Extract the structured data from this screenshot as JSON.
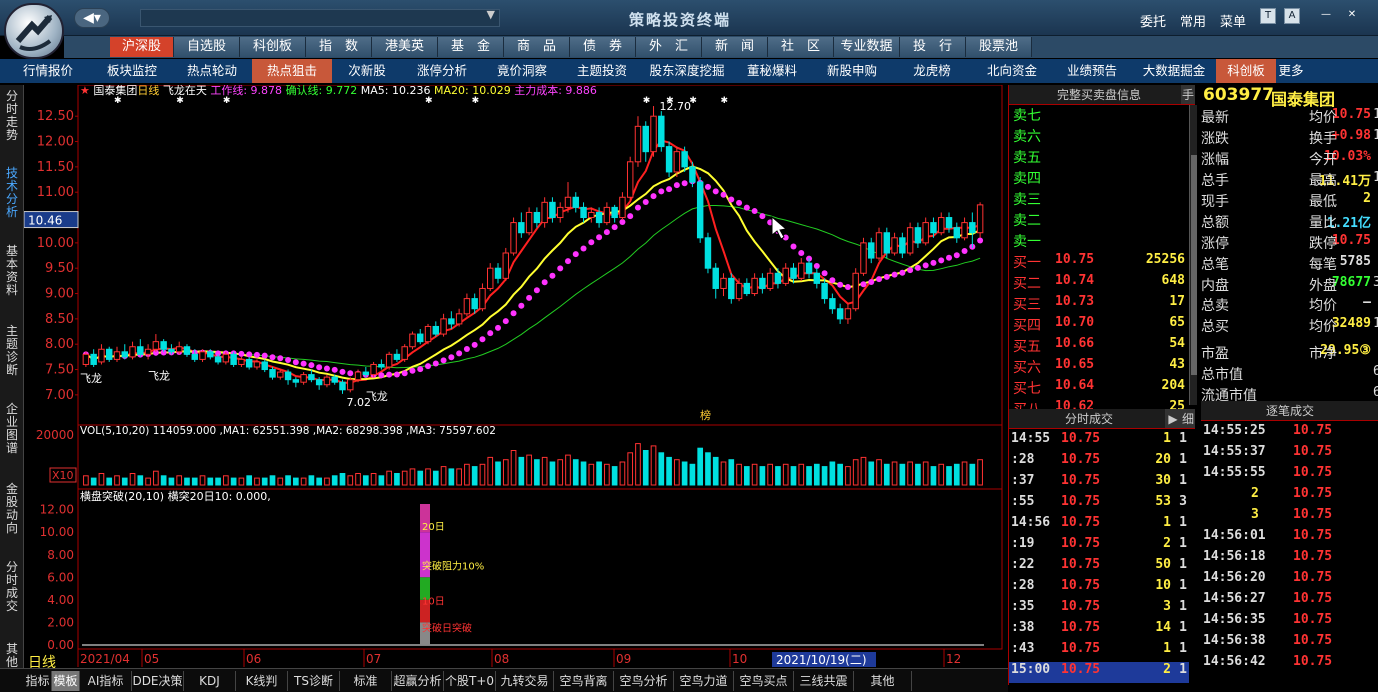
{
  "app": {
    "title": "策略投资终端",
    "links": [
      "委托",
      "常用",
      "菜单"
    ]
  },
  "menu": {
    "items": [
      "沪深股",
      "自选股",
      "科创板",
      "指　数",
      "港美英",
      "基　金",
      "商　品",
      "债　券",
      "外　汇",
      "新　闻",
      "社　区",
      "专业数据",
      "投　行",
      "股票池"
    ],
    "active": 0
  },
  "submenu": {
    "items": [
      "行情报价",
      "板块监控",
      "热点轮动",
      "热点狙击",
      "次新股",
      "涨停分析",
      "竟价洞察",
      "主题投资",
      "股东深度挖掘",
      "董秘爆料",
      "新股申购",
      "龙虎榜",
      "北向资金",
      "业绩预告",
      "大数据掘金",
      "科创板",
      "更多"
    ],
    "active": [
      3,
      15
    ]
  },
  "left_tabs": {
    "items": [
      "分时走势",
      "技术分析",
      "基本资料",
      "主题诊断",
      "企业图谱",
      "金股动向",
      "分时成交",
      "其他"
    ],
    "active": 1
  },
  "chart": {
    "stock_name": "国泰集团",
    "period": "日线",
    "title_suffix": "飞龙在天",
    "work_line": "工作线: 9.878",
    "confirm_line": "确认线: 9.772",
    "ma5": "MA5: 10.236",
    "ma20": "MA20: 10.029",
    "main_cost": "主力成本: 9.886",
    "price_ticks": [
      "12.50",
      "12.00",
      "11.50",
      "11.00",
      "10.50",
      "10.00",
      "9.50",
      "9.00",
      "8.50",
      "8.00",
      "7.50",
      "7.00"
    ],
    "crosshair_price": "10.46",
    "high_label": "12.70",
    "low_label": "7.02",
    "feilong_labels": [
      "飞龙",
      "飞龙",
      "飞龙"
    ],
    "bang_label": "榜",
    "vol_header": "VOL(5,10,20)  114059.000 ,MA1: 62551.398 ,MA2: 68298.398 ,MA3: 75597.602",
    "vol_tick": "20000",
    "vol_unit": "X10",
    "ind_header": "横盘突破(20,10)  横突20日10: 0.000,",
    "ind_ticks": [
      "12.00",
      "10.00",
      "8.00",
      "6.00",
      "4.00",
      "2.00",
      "0.00"
    ],
    "ind_labels": [
      "20日",
      "突破阻力10%",
      "10日",
      "突破日突破"
    ],
    "months": [
      "2021/04",
      "05",
      "06",
      "07",
      "08",
      "09",
      "10",
      "12"
    ],
    "cursor_date": "2021/10/19(二)",
    "colors": {
      "up": "#ff3232",
      "down": "#00e0e0",
      "ma5": "#ff2020",
      "ma20": "#ffff30",
      "cost": "#ff33ff",
      "work": "#22cc22"
    }
  },
  "chart_data": {
    "type": "candlestick",
    "series": [
      {
        "values": [
          [
            7.6,
            7.8,
            7.55,
            7.85
          ],
          [
            7.8,
            7.6,
            7.55,
            7.9
          ],
          [
            7.65,
            7.9,
            7.6,
            8.0
          ],
          [
            7.9,
            7.7,
            7.65,
            7.95
          ],
          [
            7.7,
            7.85,
            7.65,
            7.95
          ],
          [
            7.85,
            7.75,
            7.7,
            8.0
          ],
          [
            7.75,
            7.95,
            7.7,
            8.05
          ],
          [
            7.95,
            7.8,
            7.75,
            8.1
          ],
          [
            7.8,
            7.9,
            7.7,
            8.0
          ],
          [
            7.9,
            8.05,
            7.85,
            8.2
          ],
          [
            8.05,
            7.9,
            7.85,
            8.1
          ],
          [
            7.9,
            7.85,
            7.8,
            8.0
          ],
          [
            7.85,
            7.95,
            7.8,
            8.05
          ],
          [
            7.95,
            7.8,
            7.75,
            8.0
          ],
          [
            7.8,
            7.7,
            7.65,
            7.9
          ],
          [
            7.7,
            7.85,
            7.65,
            7.9
          ],
          [
            7.85,
            7.75,
            7.7,
            7.9
          ],
          [
            7.75,
            7.65,
            7.6,
            7.8
          ],
          [
            7.65,
            7.8,
            7.6,
            7.85
          ],
          [
            7.8,
            7.6,
            7.55,
            7.85
          ],
          [
            7.6,
            7.7,
            7.55,
            7.75
          ],
          [
            7.7,
            7.55,
            7.5,
            7.75
          ],
          [
            7.55,
            7.65,
            7.5,
            7.7
          ],
          [
            7.65,
            7.5,
            7.45,
            7.7
          ],
          [
            7.5,
            7.35,
            7.3,
            7.55
          ],
          [
            7.35,
            7.45,
            7.3,
            7.5
          ],
          [
            7.45,
            7.3,
            7.2,
            7.5
          ],
          [
            7.3,
            7.25,
            7.15,
            7.35
          ],
          [
            7.25,
            7.4,
            7.2,
            7.45
          ],
          [
            7.4,
            7.3,
            7.25,
            7.5
          ],
          [
            7.3,
            7.2,
            7.1,
            7.35
          ],
          [
            7.2,
            7.35,
            7.15,
            7.4
          ],
          [
            7.35,
            7.25,
            7.2,
            7.4
          ],
          [
            7.25,
            7.1,
            7.02,
            7.3
          ],
          [
            7.1,
            7.3,
            7.05,
            7.35
          ],
          [
            7.3,
            7.45,
            7.25,
            7.5
          ],
          [
            7.45,
            7.4,
            7.35,
            7.55
          ],
          [
            7.4,
            7.6,
            7.35,
            7.65
          ],
          [
            7.6,
            7.55,
            7.5,
            7.7
          ],
          [
            7.55,
            7.8,
            7.5,
            7.85
          ],
          [
            7.8,
            7.7,
            7.65,
            7.9
          ],
          [
            7.7,
            7.95,
            7.65,
            8.0
          ],
          [
            7.95,
            8.2,
            7.9,
            8.25
          ],
          [
            8.2,
            8.05,
            8.0,
            8.3
          ],
          [
            8.05,
            8.35,
            8.0,
            8.4
          ],
          [
            8.35,
            8.2,
            8.15,
            8.45
          ],
          [
            8.2,
            8.5,
            8.15,
            8.6
          ],
          [
            8.5,
            8.4,
            8.3,
            8.65
          ],
          [
            8.4,
            8.6,
            8.35,
            8.7
          ],
          [
            8.6,
            8.9,
            8.55,
            9.0
          ],
          [
            8.9,
            8.7,
            8.6,
            9.0
          ],
          [
            8.7,
            9.1,
            8.65,
            9.2
          ],
          [
            9.1,
            9.5,
            9.05,
            9.6
          ],
          [
            9.5,
            9.3,
            9.2,
            9.6
          ],
          [
            9.3,
            9.8,
            9.25,
            9.9
          ],
          [
            9.8,
            10.4,
            9.75,
            10.5
          ],
          [
            10.4,
            10.2,
            10.1,
            10.6
          ],
          [
            10.2,
            10.6,
            10.15,
            10.7
          ],
          [
            10.6,
            10.4,
            10.3,
            10.7
          ],
          [
            10.4,
            10.8,
            10.3,
            10.9
          ],
          [
            10.8,
            10.5,
            10.4,
            10.9
          ],
          [
            10.5,
            10.7,
            10.4,
            10.8
          ],
          [
            10.7,
            10.9,
            10.6,
            11.2
          ],
          [
            10.9,
            10.7,
            10.6,
            11.0
          ],
          [
            10.7,
            10.5,
            10.4,
            10.8
          ],
          [
            10.5,
            10.6,
            10.4,
            10.7
          ],
          [
            10.6,
            10.4,
            10.3,
            10.7
          ],
          [
            10.4,
            10.7,
            10.35,
            10.8
          ],
          [
            10.7,
            10.5,
            10.4,
            10.75
          ],
          [
            10.5,
            10.9,
            10.45,
            11.0
          ],
          [
            10.9,
            11.6,
            10.85,
            11.7
          ],
          [
            11.6,
            12.3,
            11.5,
            12.5
          ],
          [
            12.3,
            11.8,
            11.6,
            12.4
          ],
          [
            11.8,
            12.5,
            11.7,
            12.7
          ],
          [
            12.5,
            11.9,
            11.8,
            12.6
          ],
          [
            11.9,
            11.4,
            11.3,
            12.0
          ],
          [
            11.4,
            11.8,
            11.3,
            11.9
          ],
          [
            11.8,
            11.5,
            11.4,
            11.9
          ],
          [
            11.5,
            11.2,
            11.1,
            11.6
          ],
          [
            11.2,
            10.1,
            10.0,
            11.3
          ],
          [
            10.1,
            9.5,
            9.4,
            10.2
          ],
          [
            9.5,
            9.1,
            8.9,
            9.6
          ],
          [
            9.1,
            9.3,
            8.95,
            9.4
          ],
          [
            9.3,
            8.9,
            8.8,
            9.4
          ],
          [
            8.9,
            9.2,
            8.85,
            9.3
          ],
          [
            9.2,
            9.0,
            8.95,
            9.3
          ],
          [
            9.0,
            9.3,
            8.95,
            9.4
          ],
          [
            9.3,
            9.1,
            9.0,
            9.4
          ],
          [
            9.1,
            9.4,
            9.05,
            9.5
          ],
          [
            9.4,
            9.2,
            9.1,
            9.5
          ],
          [
            9.2,
            9.5,
            9.15,
            9.6
          ],
          [
            9.5,
            9.3,
            9.2,
            9.6
          ],
          [
            9.3,
            9.6,
            9.25,
            9.7
          ],
          [
            9.6,
            9.4,
            9.3,
            9.7
          ],
          [
            9.4,
            9.2,
            9.1,
            9.5
          ],
          [
            9.2,
            8.9,
            8.8,
            9.3
          ],
          [
            8.9,
            8.7,
            8.6,
            9.0
          ],
          [
            8.7,
            8.5,
            8.4,
            8.8
          ],
          [
            8.5,
            8.7,
            8.4,
            8.8
          ],
          [
            8.7,
            9.4,
            8.65,
            9.5
          ],
          [
            9.4,
            10.0,
            9.35,
            10.1
          ],
          [
            10.0,
            9.7,
            9.6,
            10.1
          ],
          [
            9.7,
            10.2,
            9.65,
            10.3
          ],
          [
            10.2,
            9.8,
            9.7,
            10.3
          ],
          [
            9.8,
            10.1,
            9.75,
            10.2
          ],
          [
            10.1,
            9.8,
            9.7,
            10.2
          ],
          [
            9.8,
            10.3,
            9.75,
            10.4
          ],
          [
            10.3,
            10.0,
            9.9,
            10.4
          ],
          [
            10.0,
            10.4,
            9.95,
            10.5
          ],
          [
            10.4,
            10.2,
            10.1,
            10.5
          ],
          [
            10.2,
            10.5,
            10.15,
            10.6
          ],
          [
            10.5,
            10.3,
            10.2,
            10.6
          ],
          [
            10.3,
            10.1,
            10.0,
            10.4
          ],
          [
            10.1,
            10.4,
            10.05,
            10.5
          ],
          [
            10.4,
            10.2,
            9.9,
            10.6
          ],
          [
            10.2,
            10.75,
            10.1,
            10.8
          ]
        ]
      }
    ],
    "volumes": [
      4,
      3,
      5,
      3,
      4,
      3,
      5,
      4,
      3,
      6,
      4,
      3,
      4,
      3,
      3,
      4,
      3,
      3,
      4,
      3,
      3,
      4,
      3,
      3,
      4,
      3,
      4,
      3,
      3,
      4,
      3,
      3,
      4,
      5,
      4,
      5,
      4,
      5,
      4,
      6,
      5,
      6,
      7,
      6,
      7,
      6,
      8,
      7,
      7,
      9,
      8,
      9,
      12,
      10,
      11,
      15,
      12,
      13,
      11,
      12,
      10,
      11,
      13,
      11,
      10,
      9,
      10,
      9,
      8,
      10,
      14,
      18,
      15,
      17,
      14,
      12,
      11,
      10,
      9,
      16,
      14,
      12,
      10,
      11,
      9,
      8,
      9,
      8,
      9,
      8,
      9,
      8,
      9,
      8,
      9,
      8,
      10,
      9,
      8,
      11,
      12,
      10,
      11,
      9,
      10,
      9,
      10,
      9,
      10,
      8,
      9,
      8,
      9,
      10,
      9,
      11
    ],
    "ylim": [
      6.8,
      12.8
    ]
  },
  "orderbook": {
    "header": "完整买卖盘信息",
    "side_btn": "手",
    "asks": [
      {
        "label": "卖七"
      },
      {
        "label": "卖六"
      },
      {
        "label": "卖五"
      },
      {
        "label": "卖四"
      },
      {
        "label": "卖三"
      },
      {
        "label": "卖二"
      },
      {
        "label": "卖一"
      }
    ],
    "bids": [
      {
        "label": "买一",
        "price": "10.75",
        "vol": "25256"
      },
      {
        "label": "买二",
        "price": "10.74",
        "vol": "648"
      },
      {
        "label": "买三",
        "price": "10.73",
        "vol": "17"
      },
      {
        "label": "买四",
        "price": "10.70",
        "vol": "65"
      },
      {
        "label": "买五",
        "price": "10.66",
        "vol": "54"
      },
      {
        "label": "买六",
        "price": "10.65",
        "vol": "43"
      },
      {
        "label": "买七",
        "price": "10.64",
        "vol": "204"
      },
      {
        "label": "买八",
        "price": "10.62",
        "vol": "25"
      }
    ]
  },
  "quote": {
    "code": "603977",
    "name": "国泰集团",
    "rows": [
      {
        "k": "最新",
        "v": "10.75",
        "c": "#ff3333",
        "k2": "均价",
        "v2": "1"
      },
      {
        "k": "涨跌",
        "v": "+0.98",
        "c": "#ff3333",
        "k2": "换手",
        "v2": "1"
      },
      {
        "k": "涨幅",
        "v": "10.03%",
        "c": "#ff3333",
        "k2": "今开",
        "v2": ""
      },
      {
        "k": "总手",
        "v": "11.41万",
        "c": "#ffee44",
        "k2": "最高",
        "v2": "1"
      },
      {
        "k": "现手",
        "v": "2",
        "c": "#ffee44",
        "k2": "最低",
        "v2": ""
      },
      {
        "k": "总额",
        "v": "1.21亿",
        "c": "#44ddff",
        "k2": "量比",
        "v2": ""
      },
      {
        "k": "涨停",
        "v": "10.75",
        "c": "#ff3333",
        "k2": "跌停",
        "v2": ""
      },
      {
        "k": "总笔",
        "v": "5785",
        "c": "#dddddd",
        "k2": "每笔",
        "v2": ""
      },
      {
        "k": "内盘",
        "v": "78677",
        "c": "#33ff33",
        "k2": "外盘",
        "v2": "3"
      },
      {
        "k": "总卖",
        "v": "–",
        "c": "#dddddd",
        "k2": "均价",
        "v2": ""
      },
      {
        "k": "总买",
        "v": "32489",
        "c": "#ffee44",
        "k2": "均价",
        "v2": "1"
      },
      {
        "k": "市盈",
        "v": "29.95③",
        "c": "#ffee44",
        "k2": "市净",
        "v2": ""
      },
      {
        "k": "总市值",
        "v": "",
        "c": "#dddddd",
        "k2": "",
        "v2": "62."
      },
      {
        "k": "流通市值",
        "v": "",
        "c": "#dddddd",
        "k2": "",
        "v2": "62."
      }
    ]
  },
  "ticks": {
    "header": "分时成交",
    "detail_btn": "细",
    "rows": [
      {
        "t": "14:55",
        "p": "10.75",
        "n": "1",
        "f": "1"
      },
      {
        "t": ":28",
        "p": "10.75",
        "n": "20",
        "f": "1"
      },
      {
        "t": ":37",
        "p": "10.75",
        "n": "30",
        "f": "1"
      },
      {
        "t": ":55",
        "p": "10.75",
        "n": "53",
        "f": "3"
      },
      {
        "t": "14:56",
        "p": "10.75",
        "n": "1",
        "f": "1"
      },
      {
        "t": ":19",
        "p": "10.75",
        "n": "2",
        "f": "1"
      },
      {
        "t": ":22",
        "p": "10.75",
        "n": "50",
        "f": "1"
      },
      {
        "t": ":28",
        "p": "10.75",
        "n": "10",
        "f": "1"
      },
      {
        "t": ":35",
        "p": "10.75",
        "n": "3",
        "f": "1"
      },
      {
        "t": ":38",
        "p": "10.75",
        "n": "14",
        "f": "1"
      },
      {
        "t": ":43",
        "p": "10.75",
        "n": "1",
        "f": "1"
      },
      {
        "t": "15:00",
        "p": "10.75",
        "n": "2",
        "f": "1"
      }
    ]
  },
  "trades": {
    "header": "逐笔成交",
    "rows": [
      {
        "t": "14:55:25",
        "p": "10.75"
      },
      {
        "t": "14:55:37",
        "p": "10.75"
      },
      {
        "t": "14:55:55",
        "p": "10.75"
      },
      {
        "t": "2",
        "p": "10.75"
      },
      {
        "t": "3",
        "p": "10.75"
      },
      {
        "t": "14:56:01",
        "p": "10.75"
      },
      {
        "t": "14:56:18",
        "p": "10.75"
      },
      {
        "t": "14:56:20",
        "p": "10.75"
      },
      {
        "t": "14:56:27",
        "p": "10.75"
      },
      {
        "t": "14:56:35",
        "p": "10.75"
      },
      {
        "t": "14:56:38",
        "p": "10.75"
      },
      {
        "t": "14:56:42",
        "p": "10.75"
      }
    ]
  },
  "bottom": {
    "period": "日线",
    "tabs": [
      "指标",
      "模板",
      "AI指标",
      "DDE决策",
      "KDJ",
      "K线判",
      "TS诊断",
      "标准",
      "超赢分析",
      "个股T+0",
      "九转交易",
      "空鸟背离",
      "空鸟分析",
      "空鸟力道",
      "空鸟买点",
      "三线共震",
      "其他"
    ],
    "active": 1
  }
}
